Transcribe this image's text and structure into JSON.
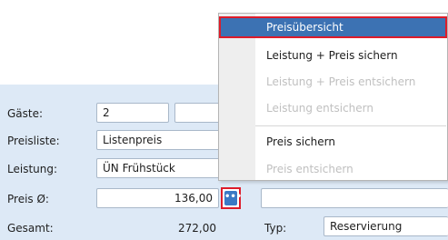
{
  "form": {
    "gaeste_label": "Gäste:",
    "gaeste_value": "2",
    "preisliste_label": "Preisliste:",
    "preisliste_value": "Listenpreis",
    "leistung_label": "Leistung:",
    "leistung_value": "ÜN Frühstück",
    "preis_label": "Preis Ø:",
    "preis_value": "136,00",
    "more_button_glyph": "•••",
    "gesamt_label": "Gesamt:",
    "gesamt_value": "272,00",
    "typ_label": "Typ:",
    "typ_value": "Reservierung"
  },
  "context_menu": {
    "items": [
      {
        "label": "Preisübersicht",
        "state": "highlighted"
      },
      {
        "label": "Leistung + Preis sichern",
        "state": "enabled"
      },
      {
        "label": "Leistung + Preis entsichern",
        "state": "disabled"
      },
      {
        "label": "Leistung entsichern",
        "state": "disabled"
      },
      {
        "label": "Preis sichern",
        "state": "enabled"
      },
      {
        "label": "Preis entsichern",
        "state": "disabled"
      }
    ]
  },
  "colors": {
    "panel_background": "#dde9f6",
    "highlight": "#3c72b3",
    "annotation_border": "#dd1c2a",
    "disabled_text": "#c0c0c0"
  }
}
